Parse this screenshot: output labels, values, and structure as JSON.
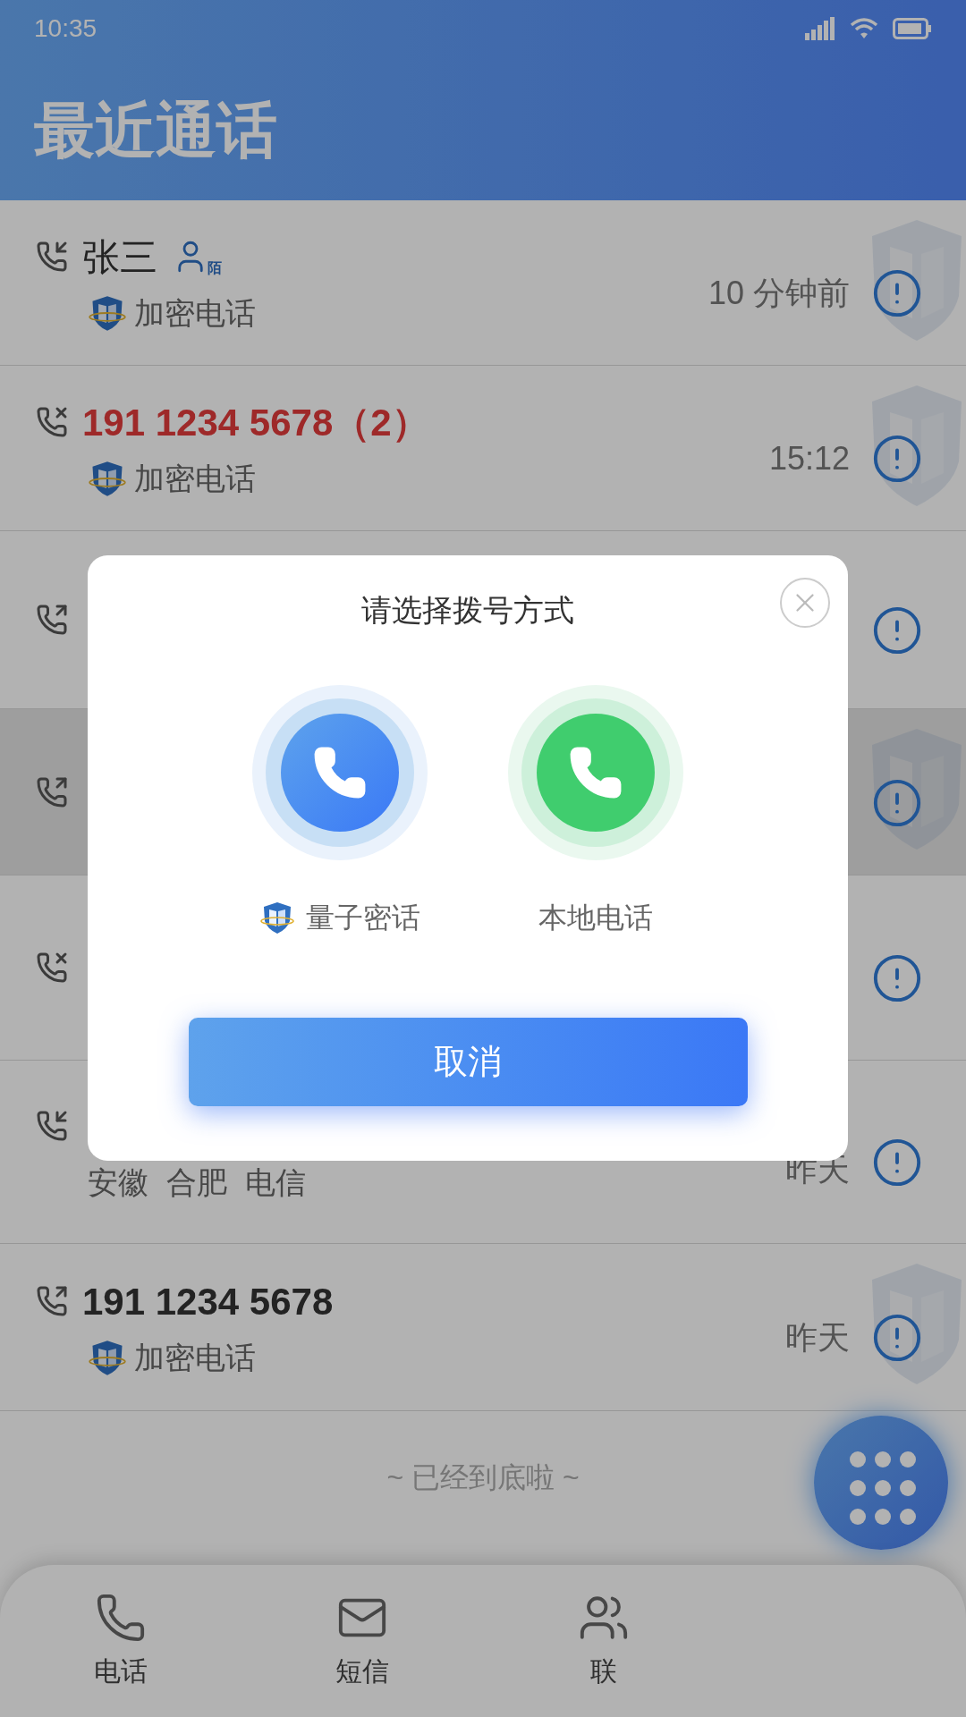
{
  "status_bar": {
    "time": "10:35"
  },
  "header": {
    "title": "最近通话"
  },
  "calls": [
    {
      "kind": "incoming",
      "name": "张三",
      "stranger_tag": "陌",
      "sub": "加密电话",
      "time": "10 分钟前",
      "encrypted": true,
      "selected": false
    },
    {
      "kind": "missed",
      "name": "191 1234 5678（2）",
      "sub": "加密电话",
      "time": "15:12",
      "encrypted": true,
      "selected": false
    },
    {
      "kind": "outgoing",
      "encrypted": false,
      "selected": false
    },
    {
      "kind": "outgoing",
      "encrypted": true,
      "selected": true
    },
    {
      "kind": "missed",
      "encrypted": false,
      "selected": false
    },
    {
      "kind": "incoming",
      "locations": [
        "安徽",
        "合肥",
        "电信"
      ],
      "time": "昨天",
      "encrypted": false,
      "selected": false
    },
    {
      "kind": "outgoing",
      "name": "191 1234 5678",
      "sub": "加密电话",
      "time": "昨天",
      "encrypted": true,
      "selected": false
    }
  ],
  "end_note": "~ 已经到底啦 ~",
  "tabs": [
    {
      "kind": "phone",
      "label": "电话"
    },
    {
      "kind": "message",
      "label": "短信"
    },
    {
      "kind": "contacts",
      "label": "联"
    }
  ],
  "dialog": {
    "title": "请选择拨号方式",
    "options": [
      {
        "kind": "quantum",
        "label": "量子密话"
      },
      {
        "kind": "local",
        "label": "本地电话"
      }
    ],
    "cancel": "取消"
  }
}
